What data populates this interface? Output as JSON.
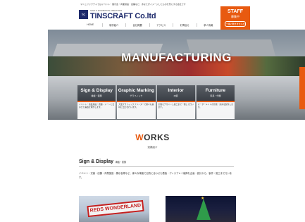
{
  "topbar": {
    "text": "マニュファクチャではイベント・展示会・商業施設・店舗など、あなたがイメージしたものを形にする会社です"
  },
  "logo": {
    "mark": "TC",
    "sub": "SIGN & EXHIBITION CREATORS",
    "name": "TINSCRAFT Co.ltd"
  },
  "nav": {
    "items": [
      "HOME",
      "制作紹介",
      "会社概要",
      "アクセス",
      "お問合せ",
      "求人情報"
    ]
  },
  "staff": {
    "title": "STAFF",
    "line2": "募集中",
    "line3": "一緒に働きませんか"
  },
  "hero": {
    "title": "MANUFACTURING"
  },
  "cards": [
    {
      "title": "Sign & Display",
      "sub": "看板・装飾",
      "desc": "イベント・商業施設・店舗…シーンに合わせた看板を制作します。"
    },
    {
      "title": "Graphic Marking",
      "sub": "グラフィック",
      "desc": "大型グラフィックプリンターで様々な素材に出力を行います。"
    },
    {
      "title": "Interior",
      "sub": "内装",
      "desc": "空間をデザインし施工まで一貫して行います。"
    },
    {
      "title": "Furniture",
      "sub": "家具・什器",
      "desc": "オーダーメイドの什器・家具を製作します。"
    }
  ],
  "works": {
    "title_accent": "W",
    "title_rest": "ORKS",
    "sub": "実績紹介"
  },
  "section": {
    "title": "Sign & Display",
    "small": "看板・装飾"
  },
  "para": {
    "text": "イベント・式典・店舗・商業施設・展示会等など、様々な場面で目的に合わせた看板・ディスプレイ装飾を企画・設計から、製作・施工まで行います。"
  },
  "photos": {
    "sign_text": "REDS WONDERLAND"
  }
}
